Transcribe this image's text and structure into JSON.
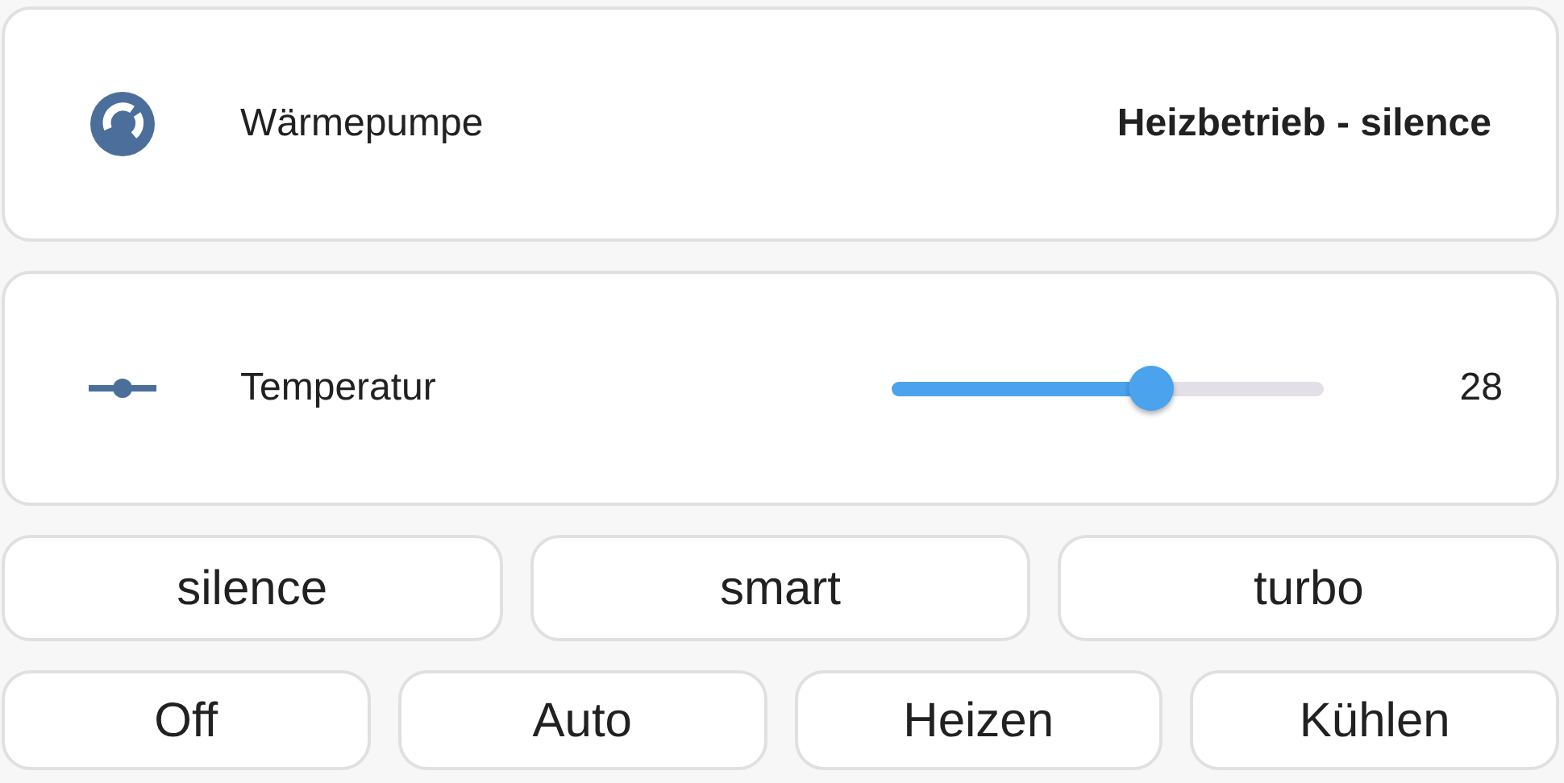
{
  "status_card": {
    "label": "Wärmepumpe",
    "value": "Heizbetrieb - silence"
  },
  "slider_card": {
    "label": "Temperatur",
    "level": 0.6,
    "reading": "28"
  },
  "mode_buttons": [
    {
      "label": "silence"
    },
    {
      "label": "smart"
    },
    {
      "label": "turbo"
    }
  ],
  "operation_buttons": [
    {
      "label": "Off"
    },
    {
      "label": "Auto"
    },
    {
      "label": "Heizen"
    },
    {
      "label": "Kühlen"
    }
  ]
}
